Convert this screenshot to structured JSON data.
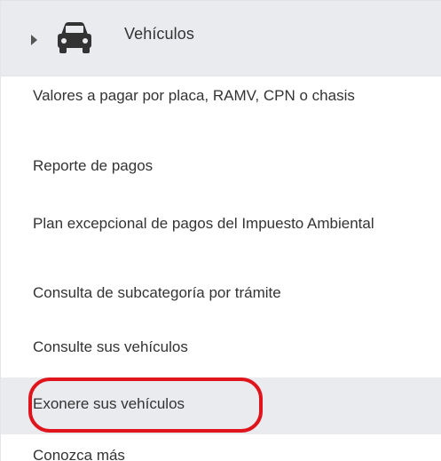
{
  "section": {
    "title": "Vehículos",
    "caret_icon": "caret-right-icon",
    "icon": "car-icon"
  },
  "items": [
    {
      "label": "Valores a pagar por placa, RAMV, CPN o chasis"
    },
    {
      "label": "Reporte de pagos"
    },
    {
      "label": "Plan excepcional de pagos del Impuesto Ambiental"
    },
    {
      "label": "Consulta de subcategoría por trámite"
    },
    {
      "label": "Consulte sus vehículos"
    },
    {
      "label": "Exonere sus vehículos"
    },
    {
      "label": "Conozca más"
    }
  ],
  "colors": {
    "header_bg": "#e9ebee",
    "text": "#333333",
    "highlight_circle": "#e0141c"
  }
}
